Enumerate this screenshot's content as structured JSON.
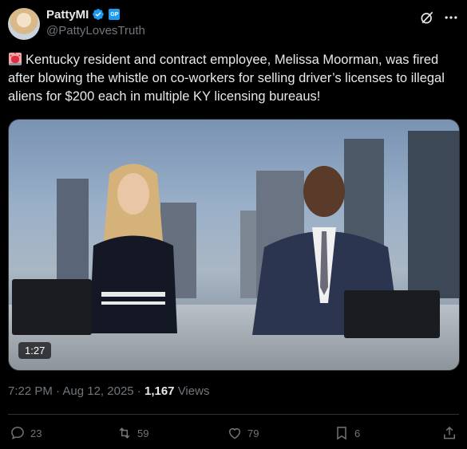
{
  "author": {
    "display_name": "PattyMI",
    "handle": "@PattyLovesTruth",
    "badge": "GP",
    "avatar_icon": "avatar"
  },
  "tweet": {
    "text": "Kentucky resident and contract employee, Melissa Moorman, was fired after blowing the whistle on co-workers for selling driver’s licenses to illegal aliens for $200 each in multiple KY licensing bureaus!",
    "emoji_icon": "siren-icon"
  },
  "video": {
    "duration": "1:27"
  },
  "meta": {
    "time": "7:22 PM",
    "separator": " · ",
    "date": "Aug 12, 2025",
    "views_count": "1,167",
    "views_label": "Views"
  },
  "actions": {
    "replies": "23",
    "reposts": "59",
    "likes": "79",
    "bookmarks": "6"
  },
  "colors": {
    "accent": "#1d9bf0",
    "text": "#e7e9ea",
    "muted": "#71767b",
    "background": "#000000"
  }
}
